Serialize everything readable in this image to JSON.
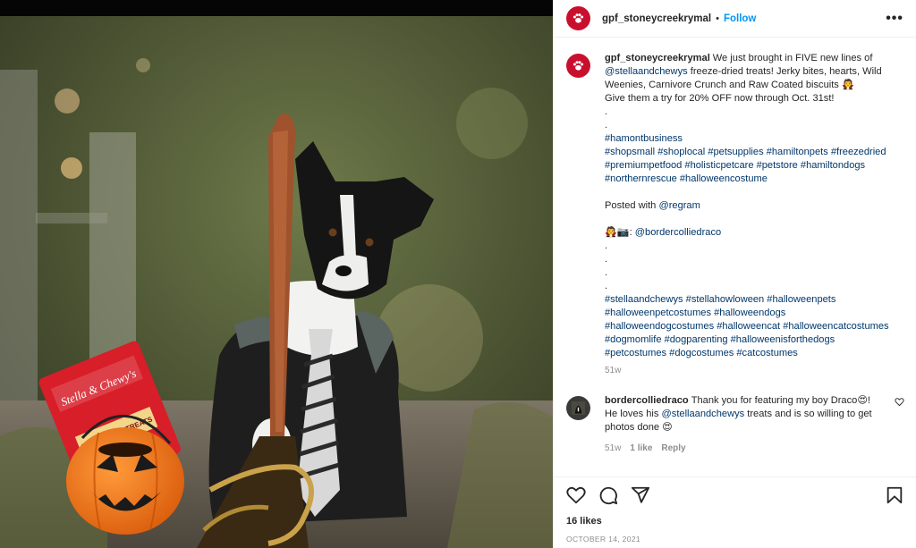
{
  "post": {
    "username": "gpf_stoneycreekrymal",
    "separator": "•",
    "follow_label": "Follow",
    "more_label": "•••"
  },
  "photo": {
    "treat_brand": "Stella & Chewy's",
    "treat_label": "BEEF HEART TREATS"
  },
  "caption": {
    "username": "gpf_stoneycreekrymal",
    "line1_text": "We just brought in FIVE new lines of",
    "line2_mention": "@stellaandchewys",
    "line2_text": " freeze-dried treats! Jerky bites, hearts, Wild",
    "line3_text": "Weenies, Carnivore Crunch and Raw Coated biscuits 🧛",
    "line4_text": "Give them a try for 20% OFF now through Oct. 31st!",
    "dot1": ".",
    "dot2": ".",
    "tags1": "#hamontbusiness",
    "tags2": "#shopsmall #shoplocal #petsupplies #hamiltonpets #freezedried",
    "tags3": "#premiumpetfood #holisticpetcare #petstore #hamiltondogs",
    "tags4": "#northernrescue #halloweencostume",
    "posted_with": "Posted with ",
    "regram": "@regram",
    "credit_emoji": "🧛📷: ",
    "credit_mention": "@bordercolliedraco",
    "dot3": ".",
    "dot4": ".",
    "dot5": ".",
    "dot6": ".",
    "tags5": "#stellaandchewys #stellahowloween #halloweenpets",
    "tags6": "#halloweenpetcostumes #halloweendogs",
    "tags7": "#halloweendogcostumes #halloweencat #halloweencatcostumes",
    "tags8": "#dogmomlife #dogparenting #halloweenisforthedogs",
    "tags9": "#petcostumes #dogcostumes #catcostumes",
    "time": "51w"
  },
  "reply": {
    "username": "bordercolliedraco",
    "line1_text": "Thank you for featuring my boy Draco😍!",
    "line2_text": "He loves his ",
    "line2_mention": "@stellaandchewys",
    "line2_rest": " treats and is so willing to get",
    "line3_text": "photos done 😍",
    "time": "51w",
    "likes": "1 like",
    "reply_label": "Reply"
  },
  "footer": {
    "likes": "16 likes",
    "date": "OCTOBER 14, 2021"
  },
  "colors": {
    "link": "#00376b",
    "follow": "#0095f6",
    "meta": "#8e8e8e",
    "brand_avatar": "#c8102e"
  }
}
